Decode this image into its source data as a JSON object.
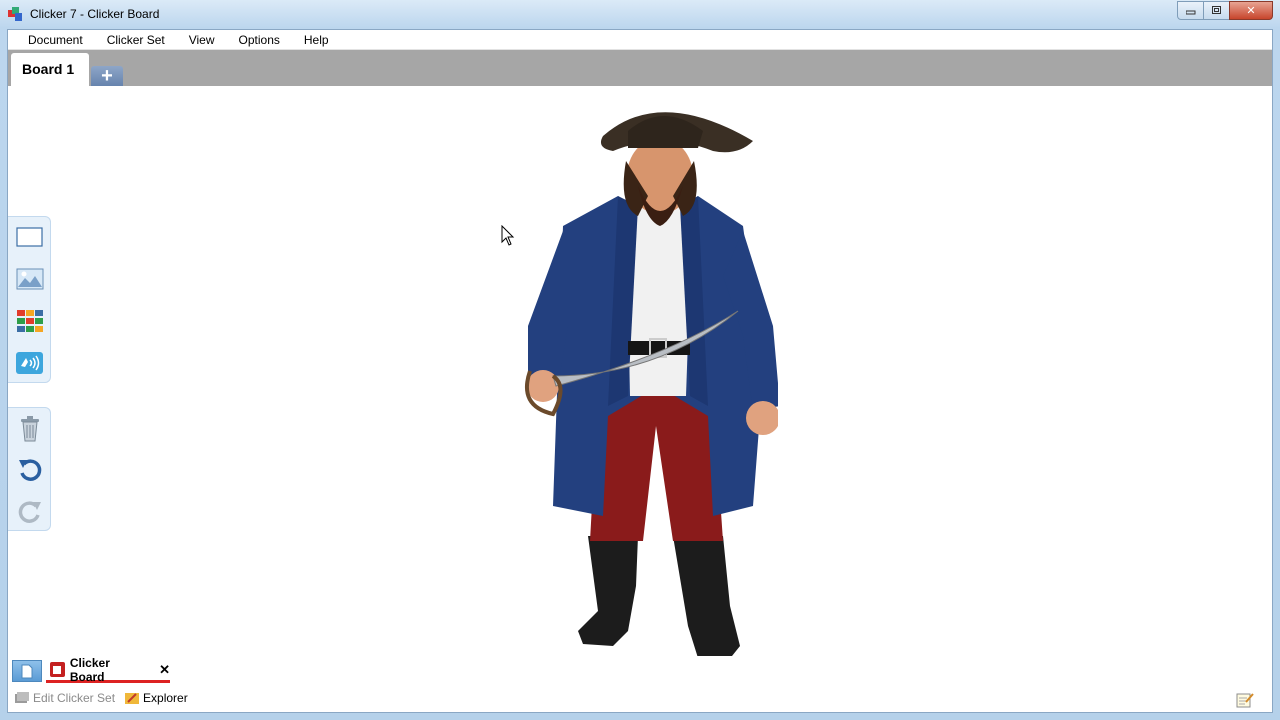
{
  "window": {
    "title": "Clicker 7 - Clicker Board",
    "controls": {
      "minimize": "▭",
      "restore": "⧉",
      "close": "✕"
    }
  },
  "menu": {
    "items": [
      "Document",
      "Clicker Set",
      "View",
      "Options",
      "Help"
    ]
  },
  "tabs": {
    "active_label": "Board 1",
    "add_label": "+"
  },
  "tools": {
    "top": [
      "blank-cell-icon",
      "picture-icon",
      "grid-icon",
      "sound-icon"
    ],
    "bottom": [
      "trash-icon",
      "undo-icon",
      "redo-icon"
    ]
  },
  "document_tabs": {
    "active_label": "Clicker Board",
    "close_label": "✕"
  },
  "bottom_links": {
    "edit_clicker_set": "Edit Clicker Set",
    "explorer": "Explorer"
  },
  "colors": {
    "accent": "#4a8fd0",
    "tab_strip": "#a6a6a6",
    "doc_tab_underline": "#dd2222"
  }
}
